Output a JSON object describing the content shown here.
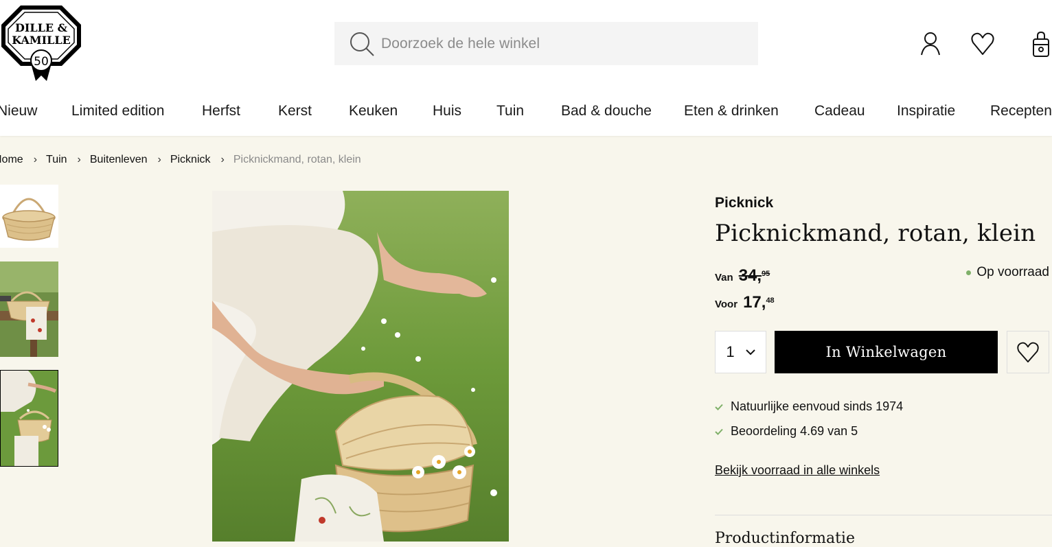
{
  "brand": {
    "logo_line1": "DILLE &",
    "logo_line2": "KAMILLE",
    "logo_badge": "50"
  },
  "search": {
    "placeholder": "Doorzoek de hele winkel"
  },
  "header_icons": [
    "account-icon",
    "wishlist-heart-icon",
    "cart-bag-icon"
  ],
  "nav": {
    "items": [
      "Nieuw",
      "Limited edition",
      "Herfst",
      "Kerst",
      "Keuken",
      "Huis",
      "Tuin",
      "Bad & douche",
      "Eten & drinken",
      "Cadeau",
      "Inspiratie",
      "Recepten"
    ]
  },
  "breadcrumb": {
    "items": [
      "Home",
      "Tuin",
      "Buitenleven",
      "Picknick"
    ],
    "current": "Picknickmand, rotan, klein"
  },
  "product": {
    "category": "Picknick",
    "title": "Picknickmand, rotan, klein",
    "price_old": {
      "label": "Van",
      "euros": "34,",
      "cents": "95"
    },
    "price_new": {
      "label": "Voor",
      "euros": "17,",
      "cents": "48"
    },
    "stock_status": "Op voorraad",
    "quantity": "1",
    "add_to_cart_label": "In Winkelwagen",
    "usps": [
      "Natuurlijke eenvoud sinds 1974",
      "Beoordeling 4.69 van 5"
    ],
    "stores_link": "Bekijk voorraad in alle winkels",
    "info_section_title": "Productinformatie"
  },
  "colors": {
    "accent_black": "#000000",
    "page_bg": "#f8f6ec",
    "stock_green": "#7fb069"
  }
}
